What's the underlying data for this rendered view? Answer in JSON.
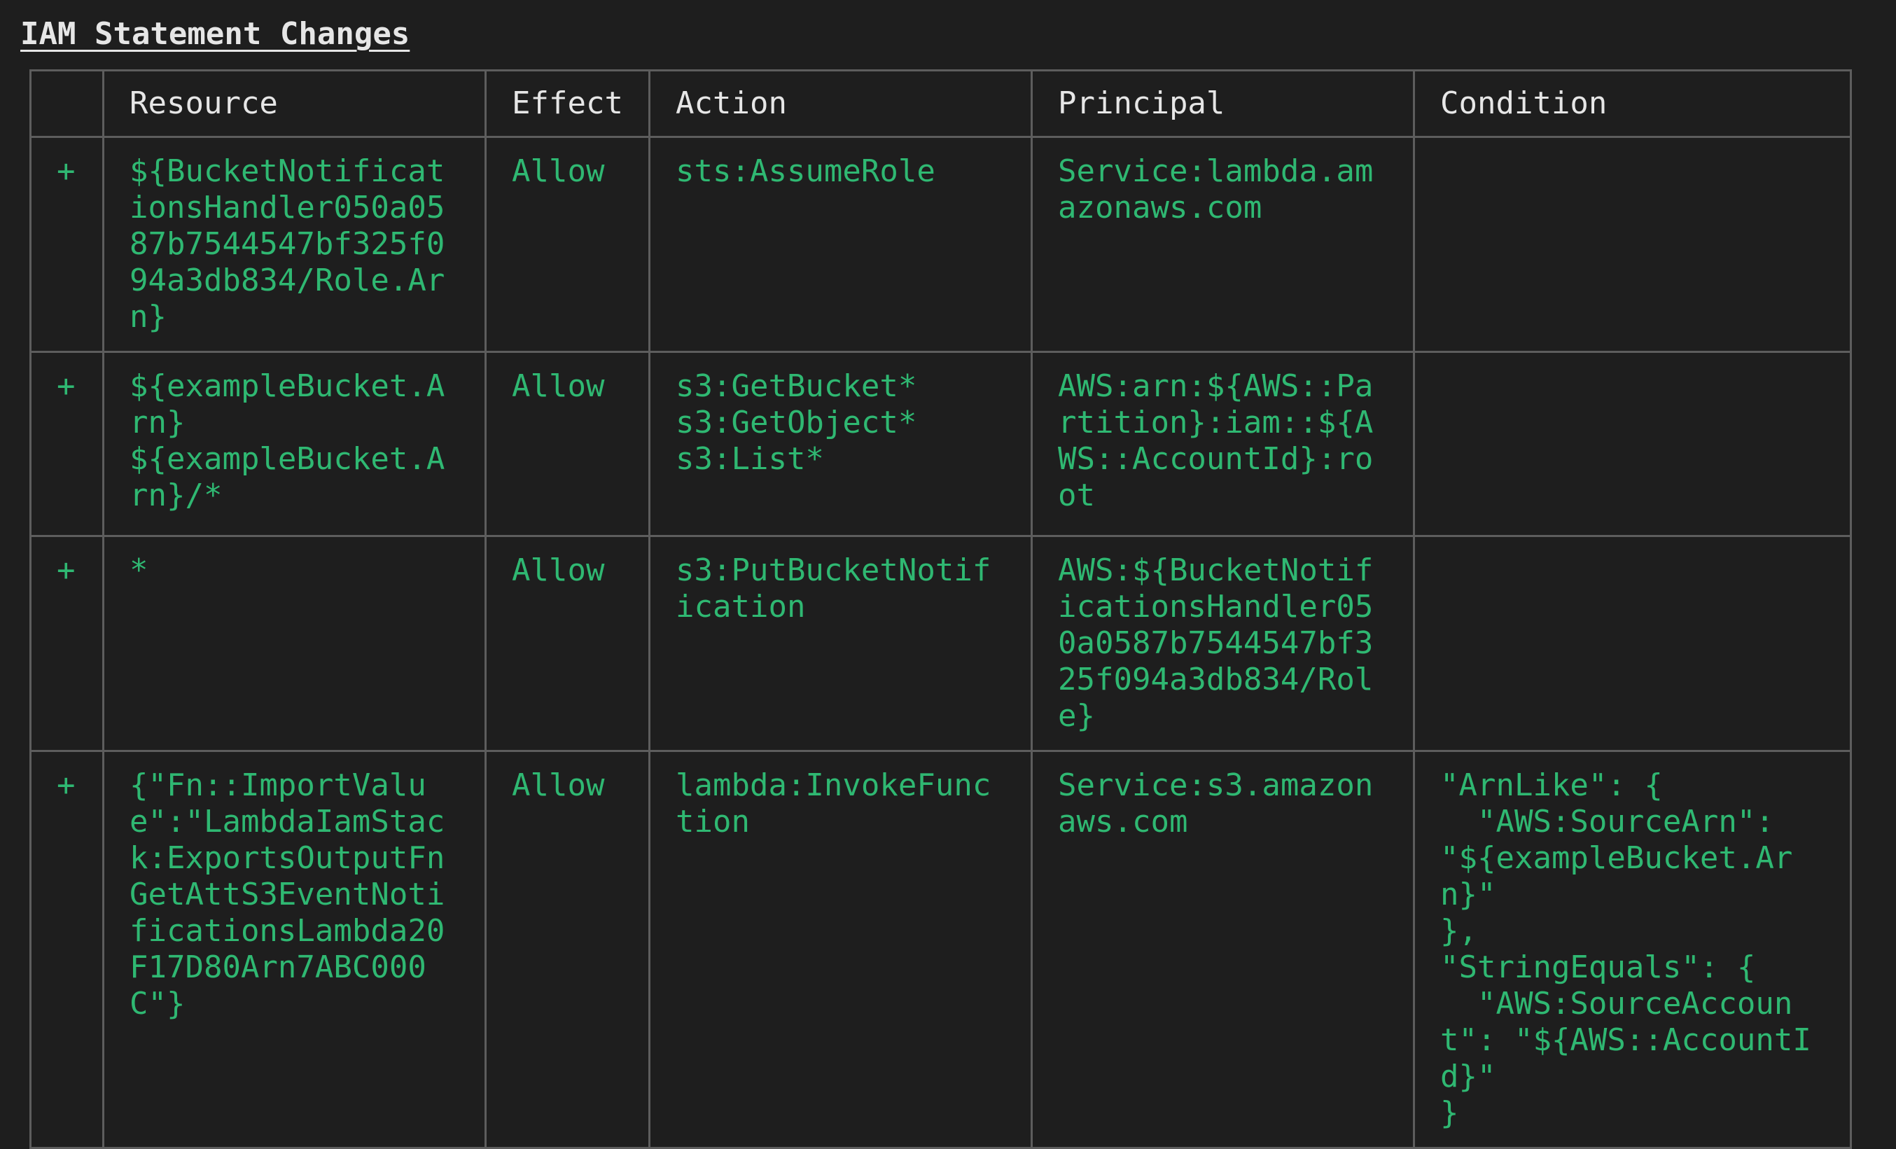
{
  "title": "IAM Statement Changes",
  "columns": [
    "",
    "Resource",
    "Effect",
    "Action",
    "Principal",
    "Condition"
  ],
  "rows": [
    {
      "sign": "+",
      "resource": "${BucketNotificationsHandler050a0587b7544547bf325f094a3db834/Role.Arn}",
      "effect": "Allow",
      "action": "sts:AssumeRole",
      "principal": "Service:lambda.amazonaws.com",
      "condition": ""
    },
    {
      "sign": "+",
      "resource": "${exampleBucket.Arn}\n${exampleBucket.Arn}/*",
      "effect": "Allow",
      "action": "s3:GetBucket*\ns3:GetObject*\ns3:List*",
      "principal": "AWS:arn:${AWS::Partition}:iam::${AWS::AccountId}:root",
      "condition": ""
    },
    {
      "sign": "+",
      "resource": "*",
      "effect": "Allow",
      "action": "s3:PutBucketNotification",
      "principal": "AWS:${BucketNotificationsHandler050a0587b7544547bf325f094a3db834/Role}",
      "condition": ""
    },
    {
      "sign": "+",
      "resource": "{\"Fn::ImportValue\":\"LambdaIamStack:ExportsOutputFnGetAttS3EventNotificationsLambda20F17D80Arn7ABC000C\"}",
      "effect": "Allow",
      "action": "lambda:InvokeFunction",
      "principal": "Service:s3.amazonaws.com",
      "condition": "\"ArnLike\": {\n  \"AWS:SourceArn\": \"${exampleBucket.Arn}\"\n},\n\"StringEquals\": {\n  \"AWS:SourceAccount\": \"${AWS::AccountId}\"\n}"
    }
  ]
}
